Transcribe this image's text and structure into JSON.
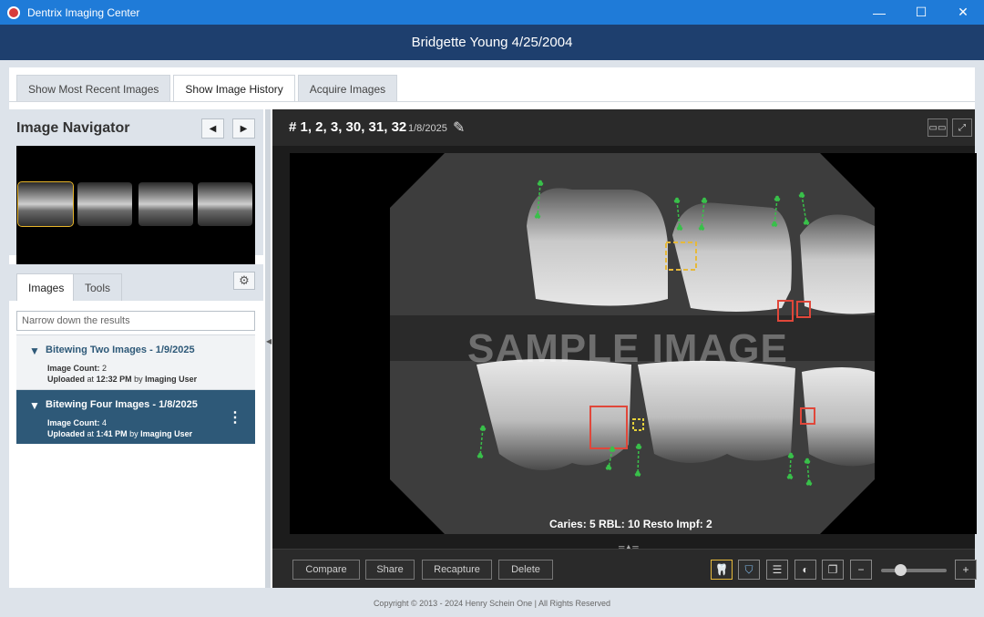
{
  "window": {
    "title": "Dentrix Imaging Center",
    "controls": [
      "—",
      "☐",
      "✕"
    ]
  },
  "patient": {
    "header": "Bridgette Young 4/25/2004"
  },
  "tabs": [
    {
      "label": "Show Most Recent Images",
      "active": false
    },
    {
      "label": "Show Image History",
      "active": true
    },
    {
      "label": "Acquire Images",
      "active": false
    }
  ],
  "navigator": {
    "title": "Image Navigator",
    "prev_icon": "◀",
    "next_icon": "▶",
    "thumbnail_count": 4,
    "selected_thumbnail": 0
  },
  "left_tabs": {
    "images": "Images",
    "tools": "Tools",
    "gear_icon": "⚙"
  },
  "search": {
    "placeholder": "Narrow down the results",
    "value": ""
  },
  "history": [
    {
      "title": "Bitewing Two Images - 1/9/2025",
      "count_label": "Image Count:",
      "count": "2",
      "uploaded_label": "Uploaded",
      "at": "at",
      "time": "12:32 PM",
      "by": "by",
      "user": "Imaging User",
      "active": false
    },
    {
      "title": "Bitewing Four Images - 1/8/2025",
      "count_label": "Image Count:",
      "count": "4",
      "uploaded_label": "Uploaded",
      "at": "at",
      "time": "1:41 PM",
      "by": "by",
      "user": "Imaging User",
      "active": true,
      "menu_icon": "⋮"
    }
  ],
  "viewer": {
    "teeth": "# 1, 2, 3, 30, 31, 32",
    "date": "1/8/2025",
    "edit_icon": "✎",
    "watermark": "SAMPLE IMAGE",
    "stats": "Caries: 5 RBL: 10 Resto Impf: 2",
    "resize_glyph": "═▲═",
    "layout_icon": "▭▭",
    "expand_icon": "⤢"
  },
  "footer_buttons": {
    "compare": "Compare",
    "share": "Share",
    "recapture": "Recapture",
    "delete": "Delete"
  },
  "tool_icons": {
    "tooth_yellow": "🦷",
    "tooth_blue": "⛉",
    "adjust": "☰",
    "contrast": "◐",
    "copy": "❐",
    "zoom_out": "−",
    "zoom_in": "+"
  },
  "zoom": {
    "level": 0.25
  },
  "copyright": "Copyright © 2013 - 2024 Henry Schein One | All Rights Reserved",
  "colors": {
    "titlebar": "#1f7bd8",
    "patient_bar": "#1e3f6e",
    "selected_item": "#2e5978",
    "highlight_yellow": "#e6b93b",
    "annotation_red": "#e0473a",
    "annotation_green": "#39c04a"
  }
}
